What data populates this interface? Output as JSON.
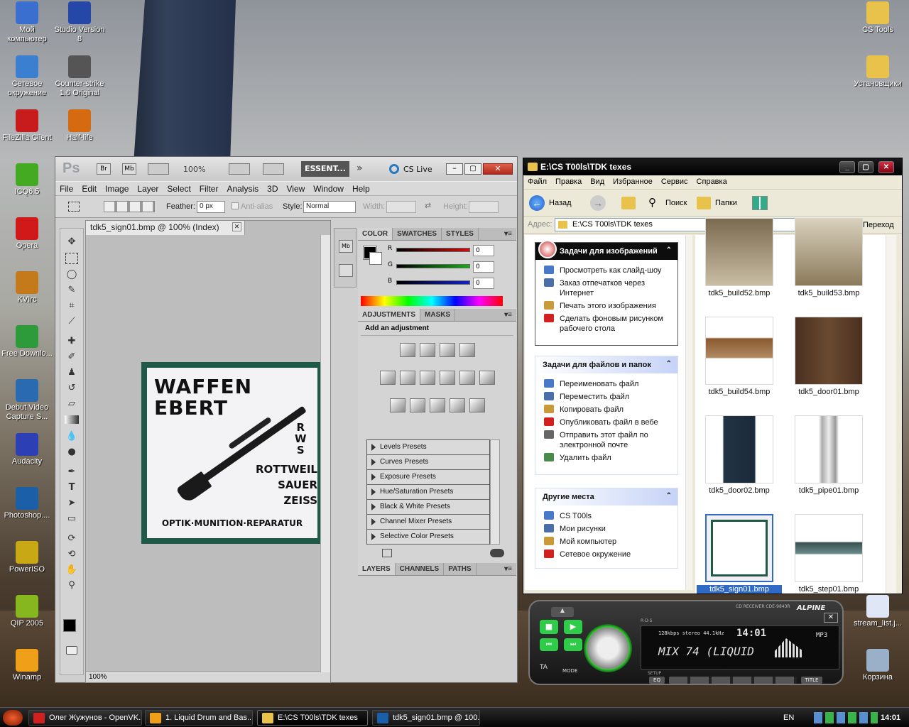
{
  "desktop": {
    "icons_left": [
      {
        "label": "Мой компьютер",
        "icon": "my-computer-icon",
        "color": "#3a6fd0"
      },
      {
        "label": "Studio Version 8",
        "icon": "studio-icon",
        "color": "#2447a8"
      },
      {
        "label": "Сетевое окружение",
        "icon": "network-icon",
        "color": "#3a7fd0"
      },
      {
        "label": "Counter-strike 1.6 Original",
        "icon": "counter-strike-icon",
        "color": "#555555"
      },
      {
        "label": "FileZilla Client",
        "icon": "filezilla-icon",
        "color": "#c81c1c"
      },
      {
        "label": "Half-life",
        "icon": "half-life-icon",
        "color": "#d66a10"
      },
      {
        "label": "ICQ6.5",
        "icon": "icq-icon",
        "color": "#44aa22"
      },
      {
        "label": "Opera",
        "icon": "opera-icon",
        "color": "#d21919"
      },
      {
        "label": "KVIrc",
        "icon": "kvirc-icon",
        "color": "#c47a1a"
      },
      {
        "label": "Free Downlo...",
        "icon": "free-download-icon",
        "color": "#2e9b3a"
      },
      {
        "label": "Debut Video Capture S...",
        "icon": "debut-icon",
        "color": "#2a6ab0"
      },
      {
        "label": "Audacity",
        "icon": "audacity-icon",
        "color": "#2c3fb5"
      },
      {
        "label": "Photoshop....",
        "icon": "photoshop-icon",
        "color": "#1b5fa8"
      },
      {
        "label": "PowerISO",
        "icon": "poweriso-icon",
        "color": "#c8a815"
      },
      {
        "label": "QIP 2005",
        "icon": "qip-icon",
        "color": "#86b71e"
      },
      {
        "label": "Winamp",
        "icon": "winamp-icon",
        "color": "#f0a018"
      }
    ],
    "icons_right": [
      {
        "label": "CS Tools",
        "icon": "folder-icon",
        "color": "#e8c24a"
      },
      {
        "label": "Установщики",
        "icon": "folder-icon",
        "color": "#e8c24a"
      },
      {
        "label": "stream_list.j...",
        "icon": "stream-file-icon",
        "color": "#dfe6f5"
      },
      {
        "label": "Корзина",
        "icon": "recycle-bin-icon",
        "color": "#9ab0c8"
      }
    ]
  },
  "photoshop": {
    "logo": "Ps",
    "br": "Br",
    "mb": "Mb",
    "zoom": "100%",
    "workspace": "ESSENT...",
    "cs_live": "CS Live",
    "menu": [
      "File",
      "Edit",
      "Image",
      "Layer",
      "Select",
      "Filter",
      "Analysis",
      "3D",
      "View",
      "Window",
      "Help"
    ],
    "options": {
      "feather_label": "Feather:",
      "feather_value": "0 px",
      "antialias": "Anti-alias",
      "style_label": "Style:",
      "style_value": "Normal",
      "width_label": "Width:",
      "height_label": "Height:"
    },
    "doc_tab": "tdk5_sign01.bmp @ 100% (Index)",
    "status_zoom": "100%",
    "sign": {
      "line1": "WAFFEN",
      "line2": "EBERT",
      "rws": [
        "R",
        "W",
        "S"
      ],
      "brands": [
        "ROTTWEIL",
        "SAUER",
        "ZEISS"
      ],
      "footer": "OPTIK·MUNITION·REPARATUR"
    },
    "color_tabs": [
      "COLOR",
      "SWATCHES",
      "STYLES"
    ],
    "rgb": [
      {
        "ch": "R",
        "val": "0",
        "color": "#d01010"
      },
      {
        "ch": "G",
        "val": "0",
        "color": "#10b010"
      },
      {
        "ch": "B",
        "val": "0",
        "color": "#1020d0"
      }
    ],
    "adj_tabs": [
      "ADJUSTMENTS",
      "MASKS"
    ],
    "adj_title": "Add an adjustment",
    "presets": [
      "Levels Presets",
      "Curves Presets",
      "Exposure Presets",
      "Hue/Saturation Presets",
      "Black & White Presets",
      "Channel Mixer Presets",
      "Selective Color Presets"
    ],
    "layer_tabs": [
      "LAYERS",
      "CHANNELS",
      "PATHS"
    ]
  },
  "explorer": {
    "title": "E:\\CS T00ls\\TDK texes",
    "menu": [
      "Файл",
      "Правка",
      "Вид",
      "Избранное",
      "Сервис",
      "Справка"
    ],
    "back": "Назад",
    "search": "Поиск",
    "folders": "Папки",
    "address_label": "Адрес:",
    "address": "E:\\CS T00ls\\TDK texes",
    "go": "Переход",
    "image_tasks": {
      "title": "Задачи для изображений",
      "items": [
        "Просмотреть как слайд-шоу",
        "Заказ отпечатков через Интернет",
        "Печать этого изображения",
        "Сделать фоновым рисунком рабочего стола"
      ]
    },
    "file_tasks": {
      "title": "Задачи для файлов и папок",
      "items": [
        "Переименовать файл",
        "Переместить файл",
        "Копировать файл",
        "Опубликовать файл в вебе",
        "Отправить этот файл по электронной почте",
        "Удалить файл"
      ]
    },
    "other_places": {
      "title": "Другие места",
      "items": [
        "CS T00ls",
        "Мои рисунки",
        "Мой компьютер",
        "Сетевое окружение"
      ]
    },
    "files": [
      "tdk5_build52.bmp",
      "tdk5_build53.bmp",
      "tdk5_build54.bmp",
      "tdk5_door01.bmp",
      "tdk5_door02.bmp",
      "tdk5_pipe01.bmp",
      "tdk5_sign01.bmp",
      "tdk5_step01.bmp"
    ]
  },
  "winamp": {
    "bitrate": "128kbps stereo 44.1kHz",
    "time": "14:01",
    "track": "MIX 74 (LIQUID",
    "brand": "ALPINE",
    "mp3": "MP3",
    "rds": "R·D·S",
    "setup": "SETUP",
    "mode": "MODE",
    "ta": "TA",
    "eq": "EQ",
    "title_btn": "TITLE",
    "cd": "CD RECEIVER CDE-9843R"
  },
  "taskbar": {
    "tasks": [
      "Олег Жужунов - OpenVK...",
      "1. Liquid Drum and Bas...",
      "E:\\CS T00ls\\TDK texes",
      "tdk5_sign01.bmp @ 100..."
    ],
    "lang": "EN",
    "clock": "14:01"
  }
}
